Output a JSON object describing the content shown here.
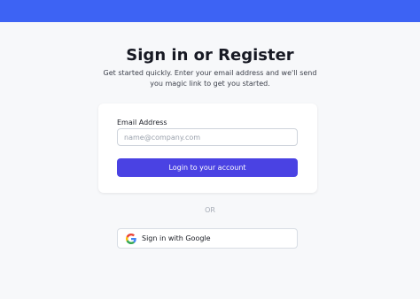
{
  "header": {
    "brand_color": "#3d63f4"
  },
  "main": {
    "title": "Sign in or Register",
    "subtitle": "Get started quickly. Enter your email address and we'll send you magic link to get you started."
  },
  "form": {
    "email_label": "Email Address",
    "email_placeholder": "name@company.com",
    "email_value": "",
    "login_label": "Login to your account",
    "login_color": "#4a42e3"
  },
  "divider": {
    "or_label": "OR"
  },
  "social": {
    "google_label": "Sign in with Google",
    "google_icon": "google-g-icon"
  }
}
